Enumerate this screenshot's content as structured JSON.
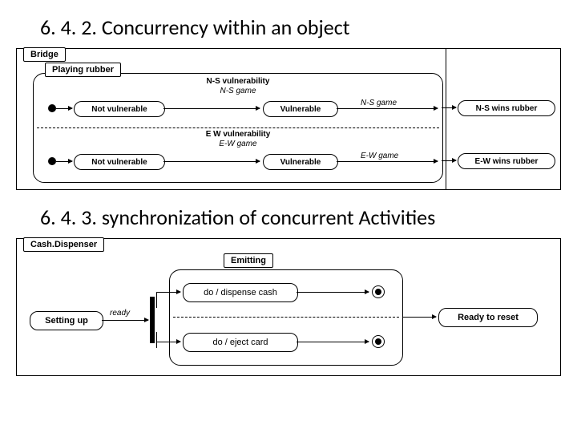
{
  "headings": {
    "h1": "6. 4. 2. Concurrency within an object",
    "h2": "6. 4. 3. synchronization of concurrent Activities"
  },
  "diagram1": {
    "frame_label": "Bridge",
    "composite_label": "Playing rubber",
    "region_top": {
      "title": "N-S vulnerability",
      "subtitle": "N-S game",
      "state1": "Not vulnerable",
      "state2": "Vulnerable",
      "exit_label": "N-S game",
      "final": "N-S wins rubber"
    },
    "region_bot": {
      "title": "E W vulnerability",
      "subtitle": "E-W game",
      "state1": "Not vulnerable",
      "state2": "Vulnerable",
      "exit_label": "E-W game",
      "final": "E-W wins rubber"
    }
  },
  "diagram2": {
    "frame_label": "Cash.Dispenser",
    "composite_label": "Emitting",
    "state_setup": "Setting up",
    "edge_ready": "ready",
    "activity1": "do / dispense cash",
    "activity2": "do / eject card",
    "state_final": "Ready to reset"
  }
}
